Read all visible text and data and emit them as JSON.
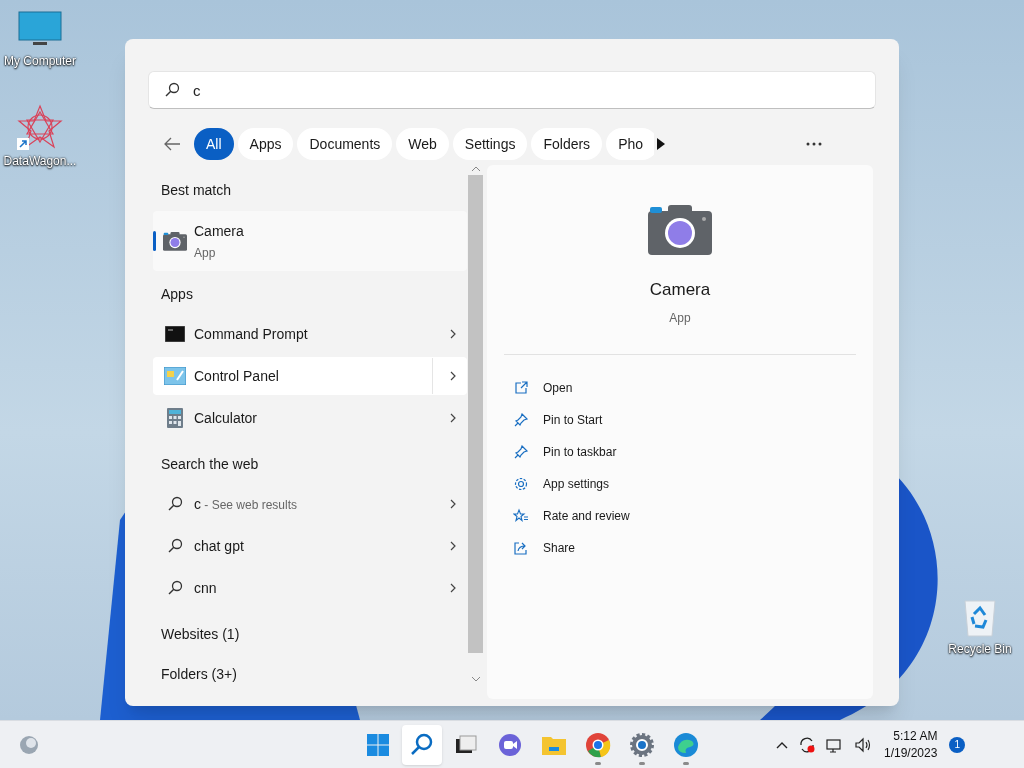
{
  "desktop_icons": [
    {
      "kind": "computer",
      "label": "My Computer"
    },
    {
      "kind": "star",
      "label": "DataWagon..."
    },
    {
      "kind": "recycle",
      "label": "Recycle Bin"
    }
  ],
  "search": {
    "value": "c"
  },
  "filters": [
    {
      "label": "All",
      "selected": true
    },
    {
      "label": "Apps",
      "selected": false
    },
    {
      "label": "Documents",
      "selected": false
    },
    {
      "label": "Web",
      "selected": false
    },
    {
      "label": "Settings",
      "selected": false
    },
    {
      "label": "Folders",
      "selected": false
    },
    {
      "label": "Pho",
      "selected": false
    }
  ],
  "results": [
    {
      "heading": "Best match",
      "items": [
        {
          "kind": "camera",
          "title": "Camera",
          "subtitle": "App",
          "selected": true
        }
      ]
    },
    {
      "heading": "Apps",
      "items": [
        {
          "kind": "cmd",
          "title": "Command Prompt",
          "selected": false,
          "hovered": false
        },
        {
          "kind": "control",
          "title": "Control Panel",
          "selected": false,
          "hovered": true
        },
        {
          "kind": "calculator",
          "title": "Calculator",
          "selected": false,
          "hovered": false
        }
      ]
    },
    {
      "heading": "Search the web",
      "items": [
        {
          "kind": "web",
          "title": "c",
          "suffix": " - See web results",
          "selected": false,
          "hovered": false
        },
        {
          "kind": "web",
          "title": "chat gpt",
          "selected": false,
          "hovered": false
        },
        {
          "kind": "web",
          "title": "cnn",
          "selected": false,
          "hovered": false
        }
      ]
    },
    {
      "heading": "Websites (1)"
    },
    {
      "heading": "Folders (3+)"
    }
  ],
  "preview": {
    "title": "Camera",
    "subtitle": "App",
    "actions": [
      {
        "kind": "open",
        "label": "Open"
      },
      {
        "kind": "pin",
        "label": "Pin to Start"
      },
      {
        "kind": "pin",
        "label": "Pin to taskbar"
      },
      {
        "kind": "settings",
        "label": "App settings"
      },
      {
        "kind": "rate",
        "label": "Rate and review"
      },
      {
        "kind": "share",
        "label": "Share"
      }
    ]
  },
  "taskbar": {
    "apps": [
      {
        "kind": "start",
        "running": false,
        "selected": false
      },
      {
        "kind": "search",
        "running": false,
        "selected": true
      },
      {
        "kind": "taskview",
        "running": false,
        "selected": false
      },
      {
        "kind": "chat",
        "running": false,
        "selected": false
      },
      {
        "kind": "explorer",
        "running": false,
        "selected": false
      },
      {
        "kind": "chrome",
        "running": true,
        "selected": false
      },
      {
        "kind": "settings",
        "running": true,
        "selected": false
      },
      {
        "kind": "edge",
        "running": true,
        "selected": false
      }
    ],
    "time": "5:12 AM",
    "date": "1/19/2023",
    "notifications": "1"
  }
}
